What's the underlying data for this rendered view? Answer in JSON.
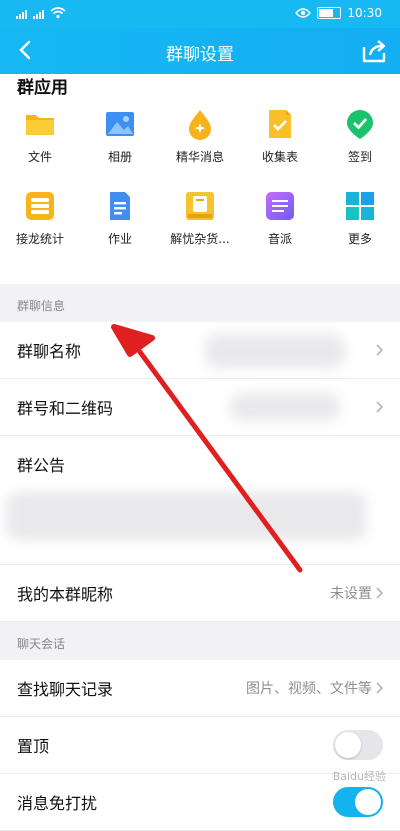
{
  "status_bar": {
    "time": "10:30"
  },
  "nav": {
    "title": "群聊设置"
  },
  "apps": {
    "title": "群应用",
    "items": [
      {
        "label": "文件",
        "icon": "folder-icon"
      },
      {
        "label": "相册",
        "icon": "album-icon"
      },
      {
        "label": "精华消息",
        "icon": "essence-icon"
      },
      {
        "label": "收集表",
        "icon": "form-icon"
      },
      {
        "label": "签到",
        "icon": "checkin-icon"
      },
      {
        "label": "接龙统计",
        "icon": "relay-icon"
      },
      {
        "label": "作业",
        "icon": "homework-icon"
      },
      {
        "label": "解忧杂货...",
        "icon": "store-icon"
      },
      {
        "label": "音派",
        "icon": "music-icon"
      },
      {
        "label": "更多",
        "icon": "more-grid-icon"
      }
    ]
  },
  "group_info": {
    "header": "群聊信息",
    "name_label": "群聊名称",
    "qr_label": "群号和二维码",
    "notice_label": "群公告",
    "nickname_label": "我的本群昵称",
    "nickname_value": "未设置"
  },
  "chat": {
    "header": "聊天会话",
    "search_label": "查找聊天记录",
    "search_value": "图片、视频、文件等",
    "pin_label": "置顶",
    "dnd_label": "消息免打扰"
  },
  "watermark": "Baidu经验",
  "colors": {
    "brand": "#14b4f2",
    "toggle_on": "#13b3ef",
    "annotation_arrow": "#e02020"
  }
}
